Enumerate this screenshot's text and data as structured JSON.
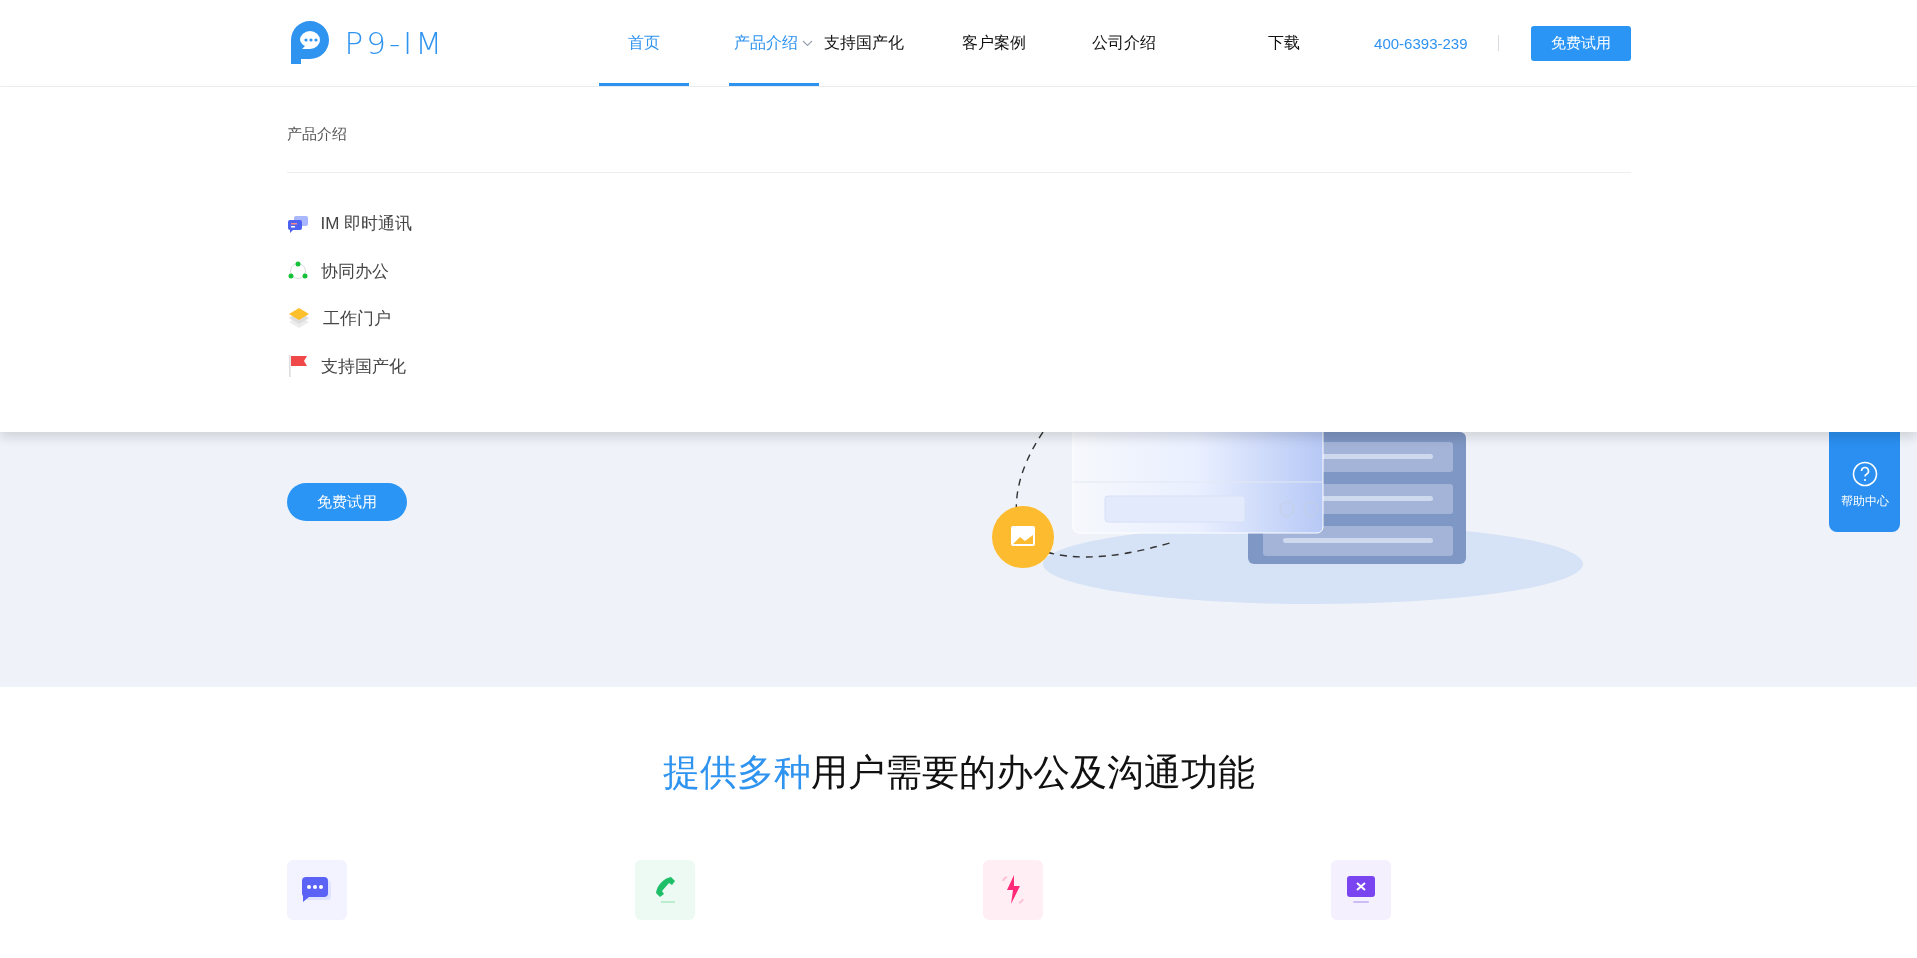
{
  "header": {
    "logo_text": "P9-IM",
    "nav": [
      {
        "label": "首页",
        "kind": "link",
        "selected": true
      },
      {
        "label": "产品介绍",
        "kind": "dropdown",
        "selected": true
      },
      {
        "label": "支持国产化",
        "kind": "link",
        "selected": false
      },
      {
        "label": "客户案例",
        "kind": "link",
        "selected": false
      },
      {
        "label": "公司介绍",
        "kind": "link",
        "selected": false
      },
      {
        "label": "下载",
        "kind": "link",
        "selected": false
      }
    ],
    "phone": "400-6393-239",
    "trial_button": "免费试用"
  },
  "dropdown": {
    "title": "产品介绍",
    "items": [
      "IM 即时通讯",
      "协同办公",
      "工作门户",
      "支持国产化"
    ]
  },
  "hero": {
    "trial_button": "免费试用"
  },
  "help_widget": {
    "label": "帮助中心"
  },
  "features_section": {
    "title_highlight": "提供多种",
    "title_rest": "用户需要的办公及沟通功能",
    "features": [
      {
        "color": "#5b63f6"
      },
      {
        "color": "#1fbf6a"
      },
      {
        "color": "#ff2a78"
      },
      {
        "color": "#7a45f0"
      }
    ]
  }
}
